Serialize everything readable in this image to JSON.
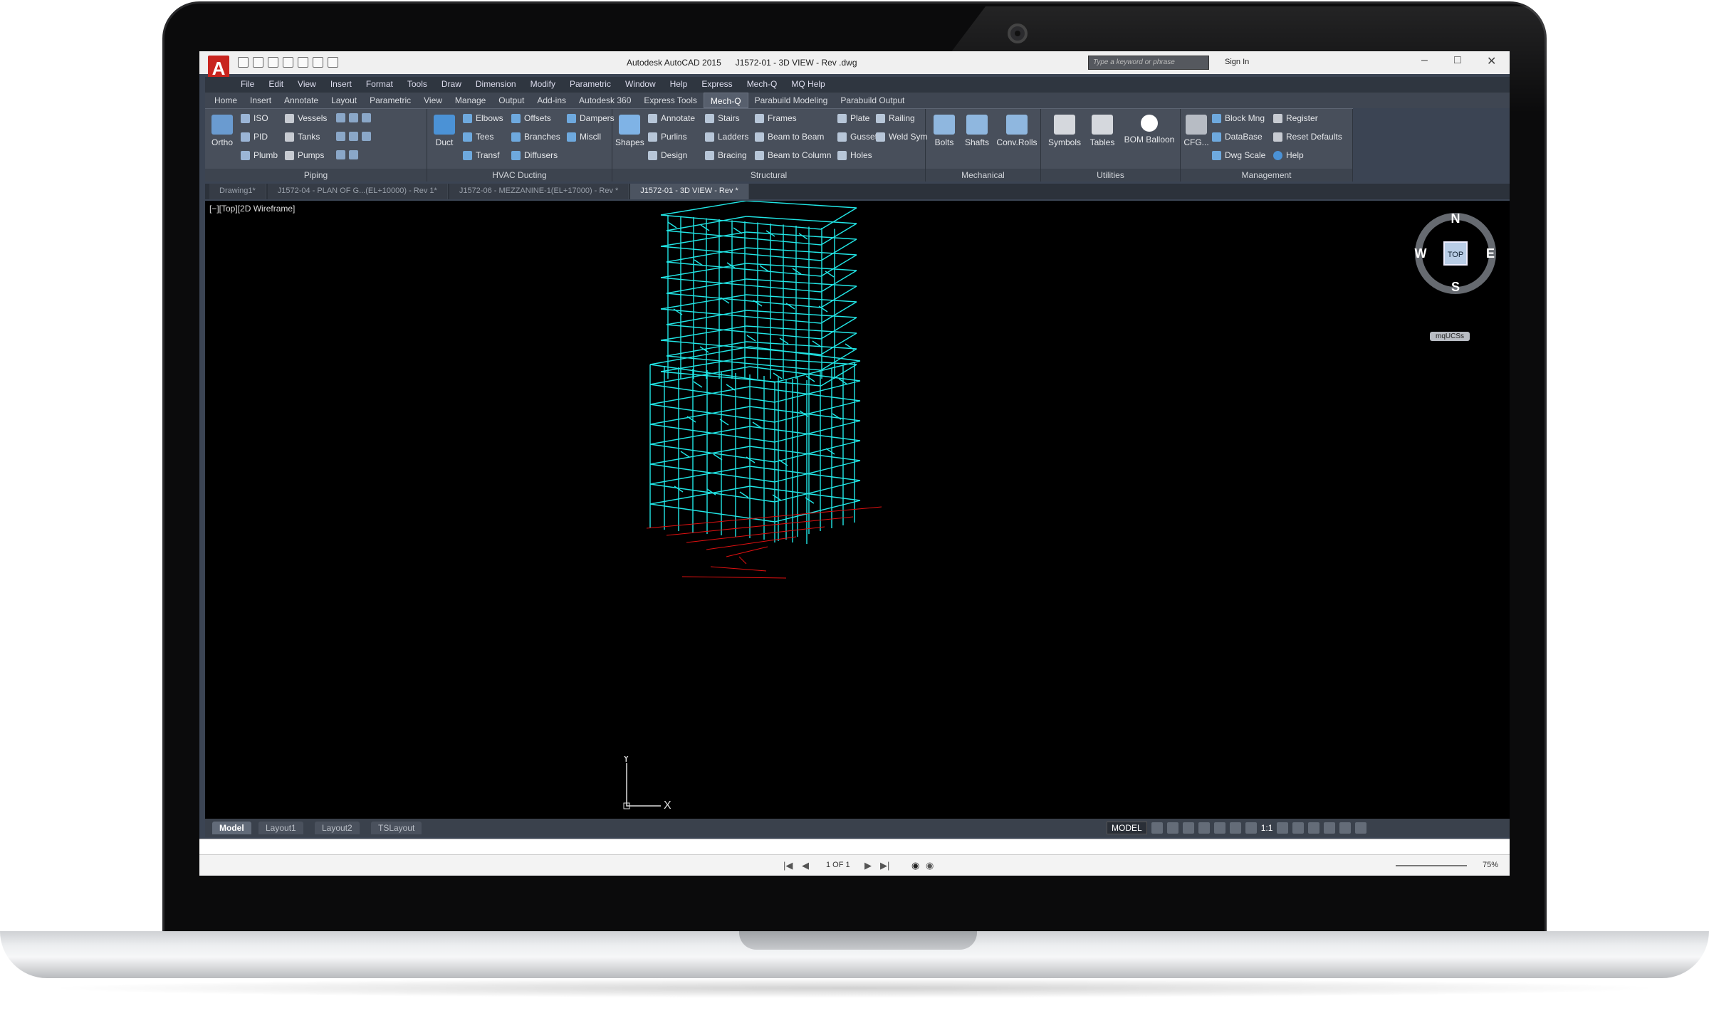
{
  "window": {
    "app_letter": "A",
    "title": "Autodesk AutoCAD 2015      J1572-01 - 3D VIEW - Rev .dwg",
    "search_placeholder": "Type a keyword or phrase",
    "sign_in": "Sign In"
  },
  "menu": [
    "File",
    "Edit",
    "View",
    "Insert",
    "Format",
    "Tools",
    "Draw",
    "Dimension",
    "Modify",
    "Parametric",
    "Window",
    "Help",
    "Express",
    "Mech-Q",
    "MQ Help"
  ],
  "ribbon_tabs": [
    "Home",
    "Insert",
    "Annotate",
    "Layout",
    "Parametric",
    "View",
    "Manage",
    "Output",
    "Add-ins",
    "Autodesk 360",
    "Express Tools",
    "Mech-Q",
    "Parabuild Modeling",
    "Parabuild Output"
  ],
  "active_ribbon_tab": "Mech-Q",
  "panels": {
    "piping": {
      "title": "Piping",
      "ortho": "Ortho",
      "iso": "ISO",
      "pid": "PID",
      "plumb": "Plumb",
      "vessels": "Vessels",
      "tanks": "Tanks",
      "pumps": "Pumps"
    },
    "hvac": {
      "title": "HVAC Ducting",
      "duct": "Duct",
      "elbows": "Elbows",
      "tees": "Tees",
      "transf": "Transf",
      "offsets": "Offsets",
      "branches": "Branches",
      "diffusers": "Diffusers",
      "dampers": "Dampers",
      "miscll": "Miscll"
    },
    "structural": {
      "title": "Structural",
      "shapes": "Shapes",
      "annotate": "Annotate",
      "purlins": "Purlins",
      "design": "Design",
      "stairs": "Stairs",
      "ladders": "Ladders",
      "bracing": "Bracing",
      "frames": "Frames",
      "beam_to_beam": "Beam to Beam",
      "beam_to_column": "Beam to Column",
      "plate": "Plate",
      "gusset": "Gusset",
      "holes": "Holes",
      "railing": "Railing",
      "weld_sym": "Weld Sym"
    },
    "mechanical": {
      "title": "Mechanical",
      "bolts": "Bolts",
      "shafts": "Shafts",
      "conv_rolls": "Conv.Rolls"
    },
    "utilities": {
      "title": "Utilities",
      "symbols": "Symbols",
      "tables": "Tables",
      "bom_balloon": "BOM Balloon"
    },
    "management": {
      "title": "Management",
      "cfg": "CFG...",
      "block_mng": "Block Mng",
      "database": "DataBase",
      "dwg_scale": "Dwg Scale",
      "register": "Register",
      "reset_defaults": "Reset Defaults",
      "help": "Help"
    }
  },
  "doc_tabs": [
    "Drawing1*",
    "J1572-04 - PLAN OF G...(EL+10000) - Rev 1*",
    "J1572-06 - MEZZANINE-1(EL+17000) - Rev *",
    "J1572-01 - 3D VIEW - Rev *"
  ],
  "active_doc_tab": "J1572-01 - 3D VIEW - Rev *",
  "viewport": {
    "label": "[−][Top][2D Wireframe]",
    "viewcube": {
      "n": "N",
      "s": "S",
      "e": "E",
      "w": "W",
      "face": "TOP"
    },
    "ucs_button": "mqUCSs",
    "axis_x": "X",
    "axis_y": "Y",
    "model_color": "#21e6e6",
    "grid_color": "#e01010"
  },
  "layout_tabs": [
    "Model",
    "Layout1",
    "Layout2",
    "TSLayout"
  ],
  "active_layout_tab": "Model",
  "status": {
    "model": "MODEL",
    "scale": "1:1"
  },
  "page": {
    "of": "1 OF 1",
    "zoom": "75%"
  }
}
